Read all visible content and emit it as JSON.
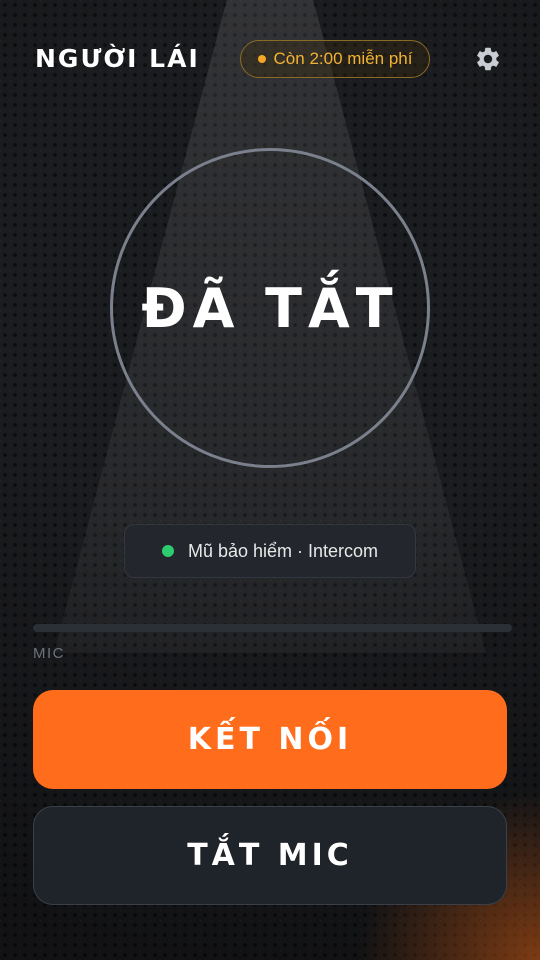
{
  "header": {
    "title": "NGƯỜI LÁI",
    "trial_badge": "Còn 2:00 miễn phí",
    "settings_icon": "gear-icon"
  },
  "status": {
    "label": "ĐÃ TẮT"
  },
  "device": {
    "label": "Mũ bảo hiểm · Intercom",
    "status_color": "#2ecc71"
  },
  "mic": {
    "label": "MIC",
    "level": 0
  },
  "actions": {
    "connect_label": "KẾT NỐI",
    "mute_label": "TẮT MIC"
  },
  "colors": {
    "accent": "#ff6d1c",
    "trial": "#f2b233",
    "background": "#1b1c1f"
  }
}
